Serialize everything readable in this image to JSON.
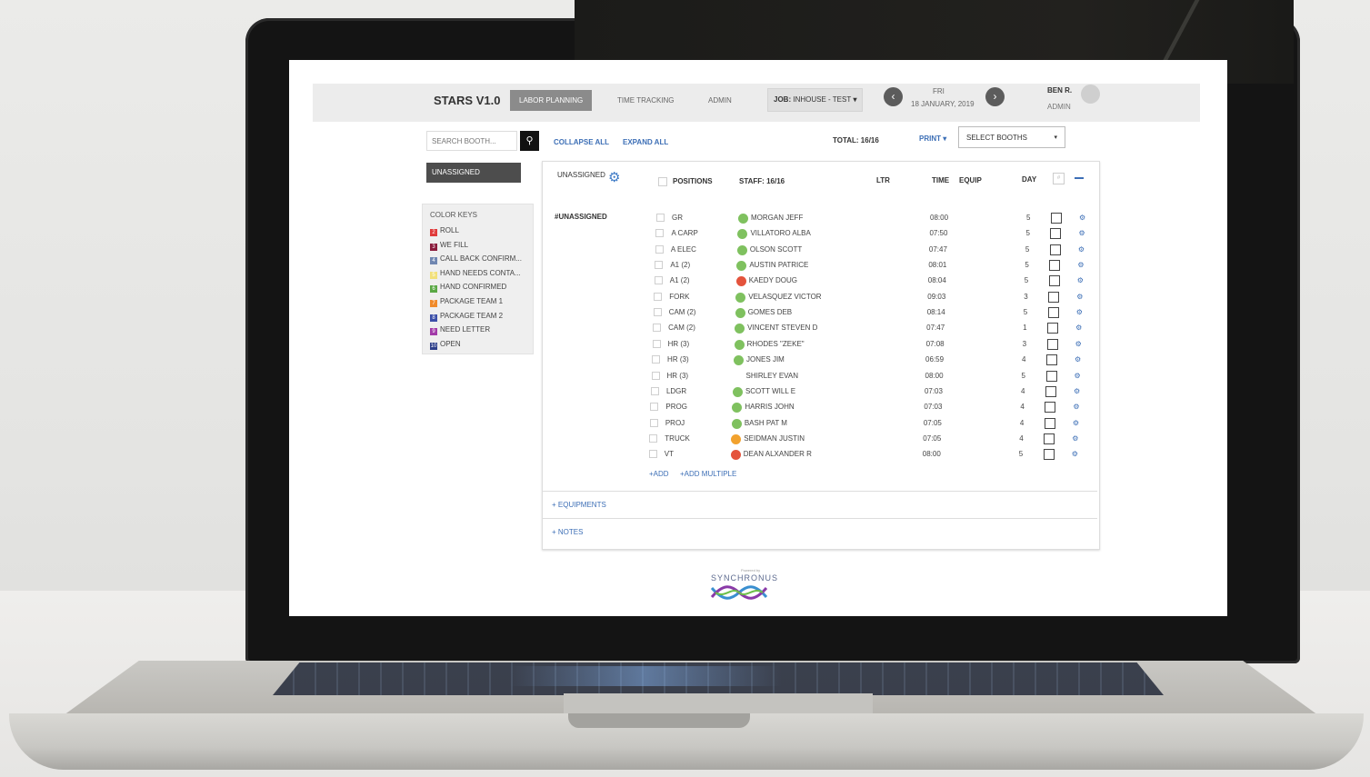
{
  "app": {
    "title": "STARS V1.0"
  },
  "nav": {
    "tabs": [
      "LABOR PLANNING",
      "TIME TRACKING",
      "ADMIN"
    ],
    "active": 0
  },
  "job": {
    "label": "JOB:",
    "value": "INHOUSE - TEST"
  },
  "date": {
    "day": "FRI",
    "full": "18 JANUARY, 2019"
  },
  "user": {
    "name": "BEN R.",
    "role": "ADMIN"
  },
  "search": {
    "placeholder": "SEARCH BOOTH..."
  },
  "sidebar": {
    "unassigned": "UNASSIGNED"
  },
  "color_keys": {
    "title": "COLOR KEYS",
    "items": [
      {
        "num": "2",
        "label": "ROLL",
        "color": "#e03a3a"
      },
      {
        "num": "3",
        "label": "WE FILL",
        "color": "#8a1c3c"
      },
      {
        "num": "4",
        "label": "CALL BACK CONFIRM...",
        "color": "#6f86b0"
      },
      {
        "num": "5",
        "label": "HAND NEEDS CONTA...",
        "color": "#f2e07a"
      },
      {
        "num": "6",
        "label": "HAND CONFIRMED",
        "color": "#5aa845"
      },
      {
        "num": "7",
        "label": "PACKAGE TEAM 1",
        "color": "#f08a2a"
      },
      {
        "num": "8",
        "label": "PACKAGE TEAM 2",
        "color": "#3b4fa8"
      },
      {
        "num": "9",
        "label": "NEED LETTER",
        "color": "#a23aa8"
      },
      {
        "num": "10",
        "label": "OPEN",
        "color": "#2d3f8a"
      }
    ]
  },
  "toolbar": {
    "collapse": "COLLAPSE ALL",
    "expand": "EXPAND ALL",
    "total": "TOTAL: 16/16",
    "print": "PRINT",
    "booths": "SELECT BOOTHS"
  },
  "table": {
    "group_header": "UNASSIGNED",
    "headers": {
      "positions": "POSITIONS",
      "staff": "STAFF: 16/16",
      "ltr": "LTR",
      "time": "TIME",
      "equip": "EQUIP",
      "day": "DAY"
    },
    "group_label": "#UNASSIGNED",
    "rows": [
      {
        "position": "GR",
        "staff": "MORGAN JEFF",
        "time": "08:00",
        "day": "5",
        "dot": "#7fc15f"
      },
      {
        "position": "A CARP",
        "staff": "VILLATORO ALBA",
        "time": "07:50",
        "day": "5",
        "dot": "#7fc15f"
      },
      {
        "position": "A ELEC",
        "staff": "OLSON SCOTT",
        "time": "07:47",
        "day": "5",
        "dot": "#7fc15f"
      },
      {
        "position": "A1 (2)",
        "staff": "AUSTIN PATRICE",
        "time": "08:01",
        "day": "5",
        "dot": "#7fc15f"
      },
      {
        "position": "A1 (2)",
        "staff": "KAEDY DOUG",
        "time": "08:04",
        "day": "5",
        "dot": "#e4533c"
      },
      {
        "position": "FORK",
        "staff": "VELASQUEZ VICTOR",
        "time": "09:03",
        "day": "3",
        "dot": "#7fc15f"
      },
      {
        "position": "CAM (2)",
        "staff": "GOMES DEB",
        "time": "08:14",
        "day": "5",
        "dot": "#7fc15f"
      },
      {
        "position": "CAM (2)",
        "staff": "VINCENT STEVEN D",
        "time": "07:47",
        "day": "1",
        "dot": "#7fc15f"
      },
      {
        "position": "HR (3)",
        "staff": "RHODES \"ZEKE\"",
        "time": "07:08",
        "day": "3",
        "dot": "#7fc15f"
      },
      {
        "position": "HR (3)",
        "staff": "JONES JIM",
        "time": "06:59",
        "day": "4",
        "dot": "#7fc15f"
      },
      {
        "position": "HR (3)",
        "staff": "SHIRLEY EVAN",
        "time": "08:00",
        "day": "5",
        "dot": ""
      },
      {
        "position": "LDGR",
        "staff": "SCOTT WILL  E",
        "time": "07:03",
        "day": "4",
        "dot": "#7fc15f"
      },
      {
        "position": "PROG",
        "staff": "HARRIS JOHN",
        "time": "07:03",
        "day": "4",
        "dot": "#7fc15f"
      },
      {
        "position": "PROJ",
        "staff": "BASH PAT M",
        "time": "07:05",
        "day": "4",
        "dot": "#7fc15f"
      },
      {
        "position": "TRUCK",
        "staff": "SEIDMAN JUSTIN",
        "time": "07:05",
        "day": "4",
        "dot": "#f2a22e"
      },
      {
        "position": "VT",
        "staff": "DEAN ALXANDER R",
        "time": "08:00",
        "day": "5",
        "dot": "#e4533c"
      }
    ],
    "add": "+ADD",
    "add_multiple": "+ADD MULTIPLE"
  },
  "sections": {
    "equipments": "+ EQUIPMENTS",
    "notes": "+ NOTES"
  },
  "footer": {
    "powered": "Powered by",
    "brand": "SYNCHRONUS"
  }
}
